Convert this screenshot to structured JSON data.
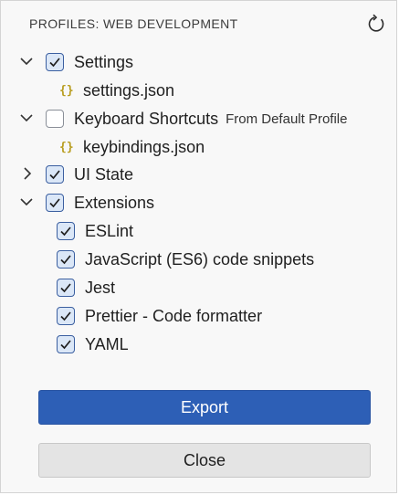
{
  "header": {
    "title": "PROFILES: WEB DEVELOPMENT",
    "refresh_icon": "refresh-icon"
  },
  "tree": {
    "settings": {
      "label": "Settings",
      "checked": true,
      "expanded": true,
      "children": [
        {
          "label": "settings.json",
          "icon": "{}"
        }
      ]
    },
    "keyboard_shortcuts": {
      "label": "Keyboard Shortcuts",
      "description": "From Default Profile",
      "checked": false,
      "expanded": true,
      "children": [
        {
          "label": "keybindings.json",
          "icon": "{}"
        }
      ]
    },
    "ui_state": {
      "label": "UI State",
      "checked": true,
      "expanded": false
    },
    "extensions": {
      "label": "Extensions",
      "checked": true,
      "expanded": true,
      "children": [
        {
          "label": "ESLint",
          "checked": true
        },
        {
          "label": "JavaScript (ES6) code snippets",
          "checked": true
        },
        {
          "label": "Jest",
          "checked": true
        },
        {
          "label": "Prettier - Code formatter",
          "checked": true
        },
        {
          "label": "YAML",
          "checked": true
        }
      ]
    }
  },
  "buttons": {
    "export_label": "Export",
    "close_label": "Close"
  },
  "colors": {
    "primary": "#2d5fb6",
    "checkbox_checked_bg": "#dbe7f7",
    "checkbox_border": "#3b5fa0",
    "json_icon": "#b89d1f"
  }
}
